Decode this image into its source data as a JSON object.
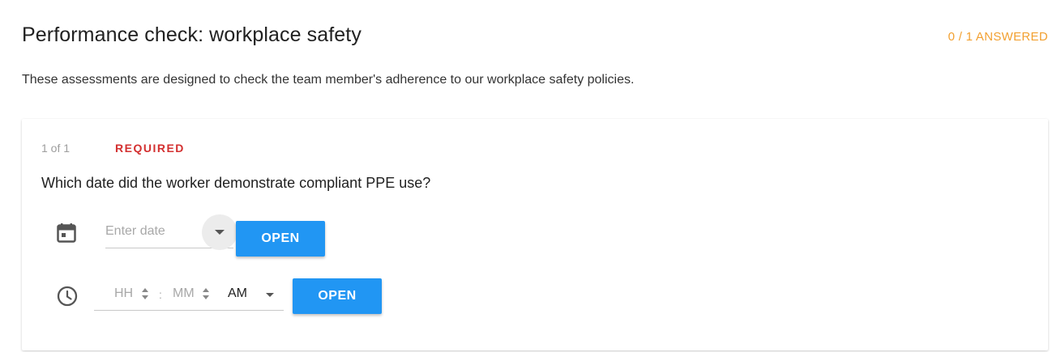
{
  "header": {
    "title": "Performance check: workplace safety",
    "answered_status": "0 / 1 ANSWERED",
    "description": "These assessments are designed to check the team member's adherence to our workplace safety policies."
  },
  "question": {
    "counter": "1 of 1",
    "required_label": "REQUIRED",
    "text": "Which date did the worker demonstrate compliant PPE use?"
  },
  "date_input": {
    "placeholder": "Enter date",
    "open_label": "OPEN",
    "icon": "calendar-icon"
  },
  "time_input": {
    "hours_placeholder": "HH",
    "minutes_placeholder": "MM",
    "separator": ":",
    "meridiem": "AM",
    "open_label": "OPEN",
    "icon": "clock-icon"
  },
  "colors": {
    "accent": "#2196f3",
    "required": "#d32f2f",
    "status": "#f2a030"
  }
}
